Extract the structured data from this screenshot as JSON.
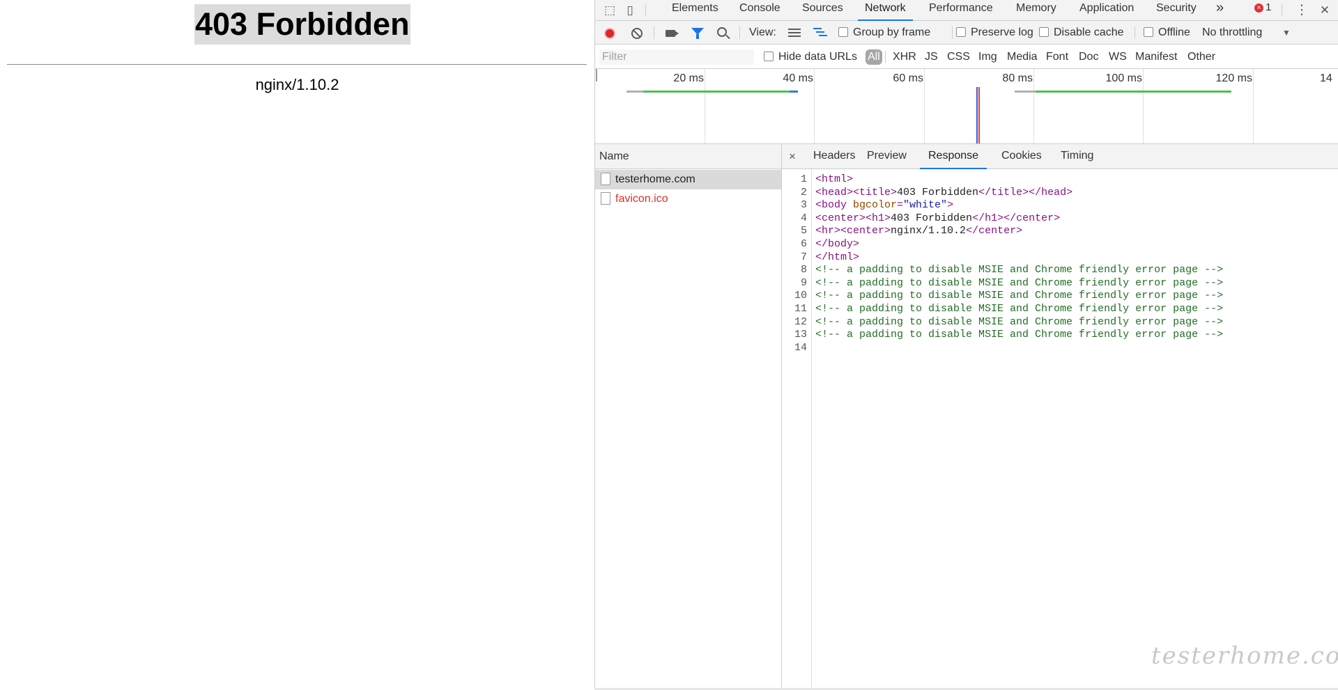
{
  "page": {
    "heading": "403 Forbidden",
    "server": "nginx/1.10.2"
  },
  "devtools": {
    "tabs": [
      "Elements",
      "Console",
      "Sources",
      "Network",
      "Performance",
      "Memory",
      "Application",
      "Security"
    ],
    "active_tab": "Network",
    "more_tabs": "»",
    "error_count": "1",
    "error_icon": "×",
    "menu_icon": "⋮",
    "close_icon": "✕",
    "toolbar": {
      "view_label": "View:",
      "group_by_frame": "Group by frame",
      "preserve_log": "Preserve log",
      "disable_cache": "Disable cache",
      "offline": "Offline",
      "throttling": "No throttling",
      "throttle_arrow": "▼"
    },
    "filter": {
      "placeholder": "Filter",
      "hide_data_urls": "Hide data URLs",
      "all": "All",
      "types": [
        "XHR",
        "JS",
        "CSS",
        "Img",
        "Media",
        "Font",
        "Doc",
        "WS",
        "Manifest",
        "Other"
      ]
    },
    "timeline": {
      "ticks": [
        "20 ms",
        "40 ms",
        "60 ms",
        "80 ms",
        "100 ms",
        "120 ms",
        "14"
      ]
    },
    "requests": {
      "header": "Name",
      "items": [
        {
          "name": "testerhome.com",
          "selected": true,
          "error": false
        },
        {
          "name": "favicon.ico",
          "selected": false,
          "error": true
        }
      ]
    },
    "detail": {
      "close": "×",
      "tabs": [
        "Headers",
        "Preview",
        "Response",
        "Cookies",
        "Timing"
      ],
      "active_tab": "Response"
    },
    "response_lines": [
      {
        "n": "1",
        "parts": [
          [
            "tag",
            "<html>"
          ]
        ]
      },
      {
        "n": "2",
        "parts": [
          [
            "tag",
            "<head><title>"
          ],
          [
            "txt",
            "403 Forbidden"
          ],
          [
            "tag",
            "</title></head>"
          ]
        ]
      },
      {
        "n": "3",
        "parts": [
          [
            "tag",
            "<body "
          ],
          [
            "attr",
            "bgcolor"
          ],
          [
            "tag",
            "="
          ],
          [
            "val",
            "\"white\""
          ],
          [
            "tag",
            ">"
          ]
        ]
      },
      {
        "n": "4",
        "parts": [
          [
            "tag",
            "<center><h1>"
          ],
          [
            "txt",
            "403 Forbidden"
          ],
          [
            "tag",
            "</h1></center>"
          ]
        ]
      },
      {
        "n": "5",
        "parts": [
          [
            "tag",
            "<hr><center>"
          ],
          [
            "txt",
            "nginx/1.10.2"
          ],
          [
            "tag",
            "</center>"
          ]
        ]
      },
      {
        "n": "6",
        "parts": [
          [
            "tag",
            "</body>"
          ]
        ]
      },
      {
        "n": "7",
        "parts": [
          [
            "tag",
            "</html>"
          ]
        ]
      },
      {
        "n": "8",
        "parts": [
          [
            "cmt",
            "<!-- a padding to disable MSIE and Chrome friendly error page -->"
          ]
        ]
      },
      {
        "n": "9",
        "parts": [
          [
            "cmt",
            "<!-- a padding to disable MSIE and Chrome friendly error page -->"
          ]
        ]
      },
      {
        "n": "10",
        "parts": [
          [
            "cmt",
            "<!-- a padding to disable MSIE and Chrome friendly error page -->"
          ]
        ]
      },
      {
        "n": "11",
        "parts": [
          [
            "cmt",
            "<!-- a padding to disable MSIE and Chrome friendly error page -->"
          ]
        ]
      },
      {
        "n": "12",
        "parts": [
          [
            "cmt",
            "<!-- a padding to disable MSIE and Chrome friendly error page -->"
          ]
        ]
      },
      {
        "n": "13",
        "parts": [
          [
            "cmt",
            "<!-- a padding to disable MSIE and Chrome friendly error page -->"
          ]
        ]
      },
      {
        "n": "14",
        "parts": []
      }
    ]
  },
  "watermark": "testerhome.com"
}
